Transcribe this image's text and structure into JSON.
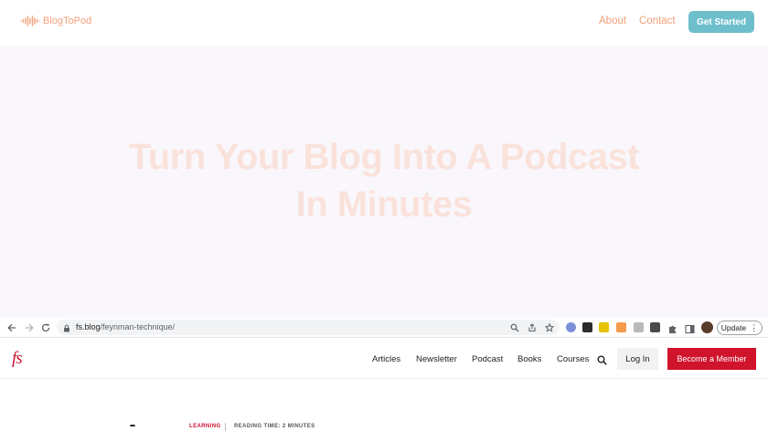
{
  "site": {
    "logo_text": "BlogToPod",
    "nav": {
      "about": "About",
      "contact": "Contact"
    },
    "cta": "Get Started",
    "accent_color": "#f2a07b",
    "cta_color": "#6ebfcc"
  },
  "hero": {
    "title_line1": "Turn Your Blog Into A Podcast",
    "title_line2": "In Minutes"
  },
  "browser": {
    "url_domain": "fs.blog",
    "url_path": "/feynman-technique/",
    "update_label": "Update",
    "icons": [
      "back-arrow-icon",
      "forward-arrow-icon",
      "reload-icon",
      "lock-icon",
      "zoom-icon",
      "share-icon",
      "bookmark-star-icon",
      "extensions-puzzle-icon",
      "side-panel-icon",
      "profile-avatar",
      "kebab-menu-icon"
    ]
  },
  "fs": {
    "logo": "fs",
    "nav": [
      "Articles",
      "Newsletter",
      "Podcast",
      "Books",
      "Courses"
    ],
    "login": "Log In",
    "member": "Become a Member",
    "brand_color": "#c8102e"
  },
  "article": {
    "category": "LEARNING",
    "reading_time": "READING TIME: 2 MINUTES"
  }
}
